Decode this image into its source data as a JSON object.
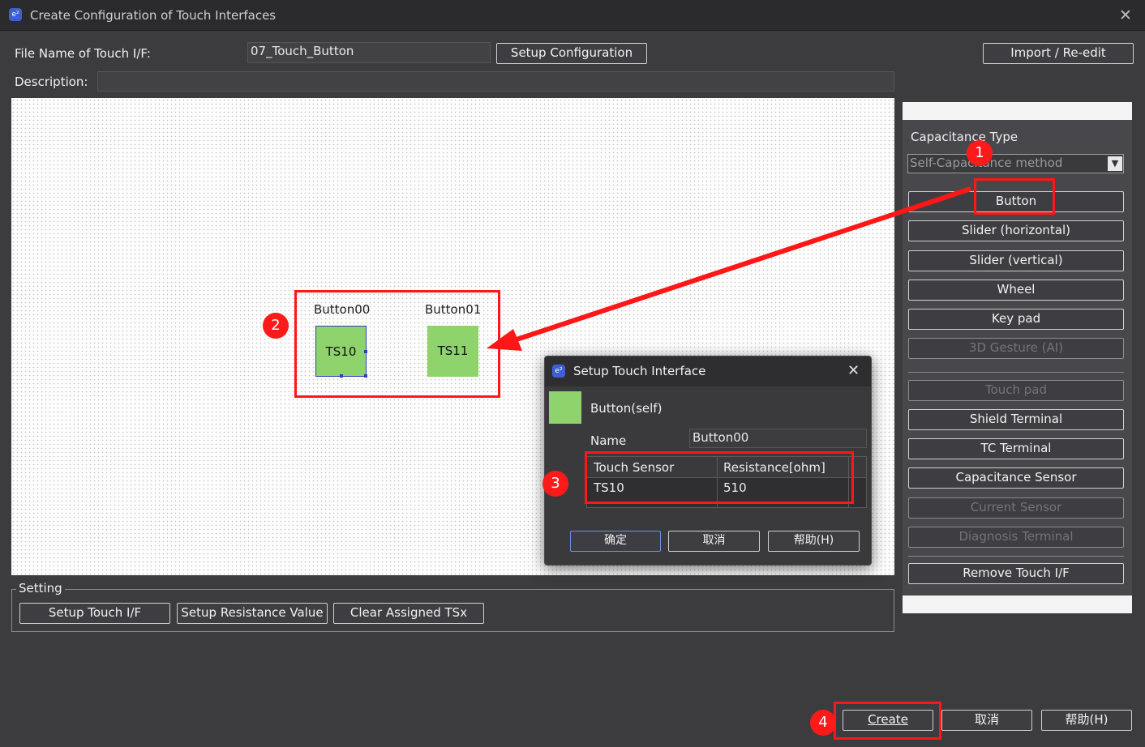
{
  "window": {
    "title": "Create Configuration of Touch Interfaces",
    "app_icon": "e²",
    "close": "✕"
  },
  "form": {
    "file_name_label": "File Name of Touch I/F:",
    "file_name_value": "07_Touch_Button",
    "setup_config_button": "Setup Configuration",
    "import_button": "Import / Re-edit",
    "description_label": "Description:",
    "description_value": ""
  },
  "canvas": {
    "buttons": [
      {
        "caption": "Button00",
        "sensor": "TS10"
      },
      {
        "caption": "Button01",
        "sensor": "TS11"
      }
    ],
    "pad_color": "#8ed36b"
  },
  "side_panel": {
    "capacitance_label": "Capacitance Type",
    "capacitance_value": "Self-Capacitance method",
    "buttons": [
      "Button",
      "Slider (horizontal)",
      "Slider (vertical)",
      "Wheel",
      "Key pad",
      "3D Gesture (AI)",
      "Touch pad",
      "Shield Terminal",
      "TC Terminal",
      "Capacitance Sensor",
      "Current Sensor",
      "Diagnosis Terminal",
      "Remove Touch I/F"
    ]
  },
  "setting": {
    "legend": "Setting",
    "buttons": [
      "Setup Touch I/F",
      "Setup Resistance Value",
      "Clear Assigned TSx"
    ]
  },
  "dialog": {
    "title": "Setup Touch Interface",
    "type_label": "Button(self)",
    "name_label": "Name",
    "name_value": "Button00",
    "table": {
      "headers": [
        "Touch Sensor",
        "Resistance[ohm]"
      ],
      "rows": [
        [
          "TS10",
          "510"
        ]
      ]
    },
    "ok": "确定",
    "cancel": "取消",
    "help": "帮助(H)"
  },
  "footer": {
    "create": "Create",
    "cancel": "取消",
    "help": "帮助(H)"
  },
  "annotations": {
    "markers": [
      "1",
      "2",
      "3",
      "4"
    ],
    "color": "#ff1616"
  }
}
